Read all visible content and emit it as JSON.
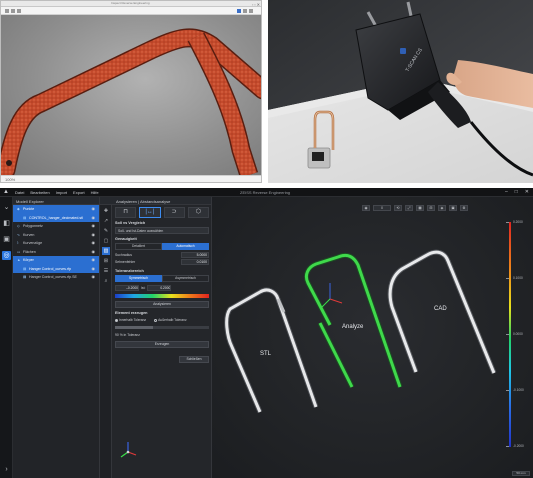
{
  "scan_window": {
    "title": "Inspect Reverse Engineering",
    "status": "100%"
  },
  "app": {
    "logo": "ZEISS",
    "menu": [
      "Datei",
      "Bearbeiten",
      "Import",
      "Export",
      "Hilfe"
    ],
    "title": "ZEISS Reverse Engineering",
    "window_controls": [
      "–",
      "□",
      "✕"
    ],
    "rail_icons": [
      "chevron-down-icon",
      "cube-icon",
      "layers-icon",
      "scan-icon"
    ]
  },
  "explorer": {
    "title": "Modell Explorer",
    "rows": [
      {
        "label": "Punkte",
        "selected": true
      },
      {
        "label": "CONTROL_hanger_decimated.stl",
        "selected": true
      },
      {
        "label": "Polygonnetz",
        "selected": false
      },
      {
        "label": "Kurven",
        "selected": false
      },
      {
        "label": "Kurvenzüge",
        "selected": false
      },
      {
        "label": "Flächen",
        "selected": false
      },
      {
        "label": "Körper",
        "selected": true
      },
      {
        "label": "Hanger Control_curves.rfp",
        "selected": true
      },
      {
        "label": "Hanger Control_curves.rfp.SE",
        "selected": false
      }
    ]
  },
  "analysis": {
    "title": "Analysieren | Abstandsanalyse",
    "mode_icons": [
      "⊓",
      "|↔|",
      "⊃",
      "⬡"
    ],
    "sub_title": "Soll vs Vergleich",
    "ref_field": "Soll- und Ist-Daten auswählen",
    "settings_title": "Genauigkeit",
    "toggle_a": [
      "Detailiert",
      "Automatisch"
    ],
    "kv": [
      {
        "label": "Suchradius",
        "value": "5.0000"
      },
      {
        "label": "Sehnenfehler",
        "value": "0.0100"
      }
    ],
    "tol_title": "Toleranzbereich",
    "toggle_b": [
      "Symmetrisch",
      "Asymmetrisch"
    ],
    "tol_row": {
      "left": "–0.2000",
      "mid": "Ist:",
      "right": "0.2000"
    },
    "analyse_button": "Analysieren",
    "element_title": "Element erzeugen",
    "radios": [
      {
        "label": "Innerhalb Toleranz",
        "on": true
      },
      {
        "label": "Außerhalb Toleranz",
        "on": false
      }
    ],
    "slider_label": "90 % in Toleranz",
    "slider_fill": 0.4,
    "create_button": "Erzeugen",
    "close_button": "Schließen"
  },
  "viewport": {
    "labels": {
      "stl": "STL",
      "analyze": "Analyze",
      "cad": "CAD"
    },
    "legend": [
      "0.2000",
      "0.1000",
      "0.0000",
      "-0.1000",
      "-0.2000"
    ],
    "status": "50 mm",
    "toolbar_value": "0"
  },
  "colors": {
    "mesh": "#c4472a",
    "good": "#3fd94b",
    "part": "#e0e0e0",
    "accent": "#2b6fd1"
  }
}
